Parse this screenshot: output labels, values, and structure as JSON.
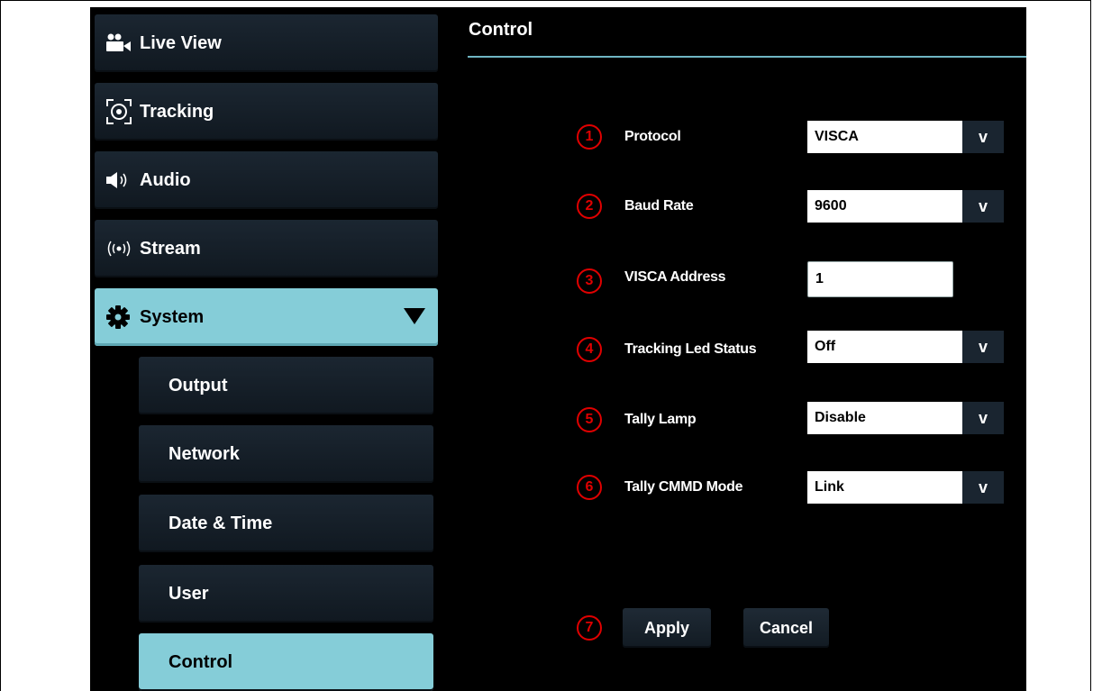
{
  "sidebar": {
    "items": [
      {
        "label": "Live View",
        "icon": "video-camera-icon"
      },
      {
        "label": "Tracking",
        "icon": "tracking-target-icon"
      },
      {
        "label": "Audio",
        "icon": "speaker-icon"
      },
      {
        "label": "Stream",
        "icon": "broadcast-icon"
      },
      {
        "label": "System",
        "icon": "gear-icon"
      }
    ],
    "system_sub_items": [
      {
        "label": "Output"
      },
      {
        "label": "Network"
      },
      {
        "label": "Date & Time"
      },
      {
        "label": "User"
      },
      {
        "label": "Control"
      }
    ]
  },
  "content": {
    "title": "Control",
    "fields": [
      {
        "num": "1",
        "label": "Protocol",
        "value": "VISCA",
        "type": "select"
      },
      {
        "num": "2",
        "label": "Baud Rate",
        "value": "9600",
        "type": "select"
      },
      {
        "num": "3",
        "label": "VISCA Address",
        "value": "1",
        "type": "input"
      },
      {
        "num": "4",
        "label": "Tracking Led Status",
        "value": "Off",
        "type": "select"
      },
      {
        "num": "5",
        "label": "Tally Lamp",
        "value": "Disable",
        "type": "select"
      },
      {
        "num": "6",
        "label": "Tally CMMD Mode",
        "value": "Link",
        "type": "select"
      }
    ],
    "actions": {
      "num": "7",
      "apply_label": "Apply",
      "cancel_label": "Cancel"
    },
    "dropdown_glyph": "v"
  },
  "colors": {
    "accent": "#85cdd8",
    "rule": "#6fb5c2",
    "annotation": "#e00000",
    "background": "#000000"
  }
}
